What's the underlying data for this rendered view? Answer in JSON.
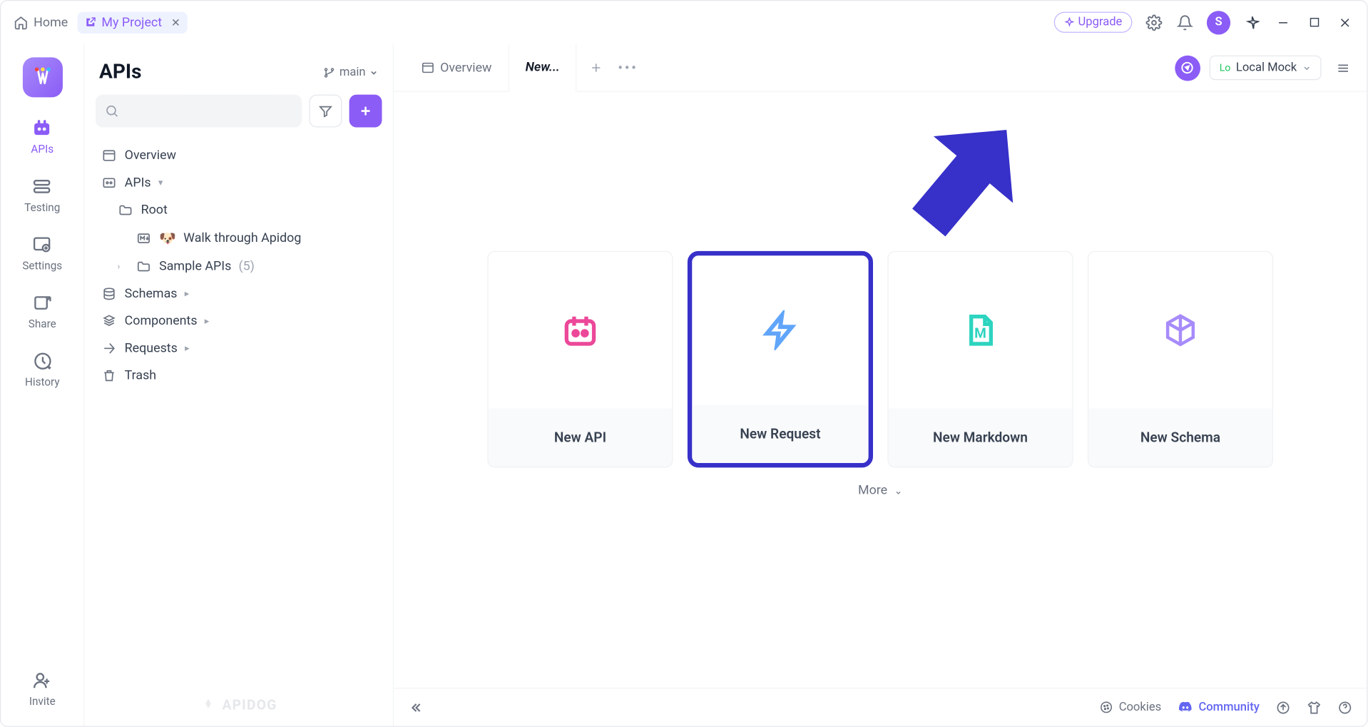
{
  "titlebar": {
    "home": "Home",
    "project_tab": "My Project",
    "upgrade": "Upgrade",
    "avatar_initial": "S"
  },
  "rail": {
    "items": [
      {
        "label": "APIs",
        "active": true
      },
      {
        "label": "Testing"
      },
      {
        "label": "Settings"
      },
      {
        "label": "Share"
      },
      {
        "label": "History"
      }
    ],
    "invite": "Invite"
  },
  "sidebar": {
    "title": "APIs",
    "branch": "main",
    "tree": {
      "overview": "Overview",
      "apis": "APIs",
      "root": "Root",
      "walk": "Walk through Apidog",
      "sample_apis": "Sample APIs",
      "sample_count": "(5)",
      "schemas": "Schemas",
      "components": "Components",
      "requests": "Requests",
      "trash": "Trash"
    },
    "brand": "APIDOG"
  },
  "tabs": {
    "overview": "Overview",
    "new": "New...",
    "env_prefix": "Lo",
    "env": "Local Mock"
  },
  "cards": [
    {
      "label": "New API"
    },
    {
      "label": "New Request"
    },
    {
      "label": "New Markdown"
    },
    {
      "label": "New Schema"
    }
  ],
  "more_label": "More",
  "bottom": {
    "cookies": "Cookies",
    "community": "Community"
  }
}
